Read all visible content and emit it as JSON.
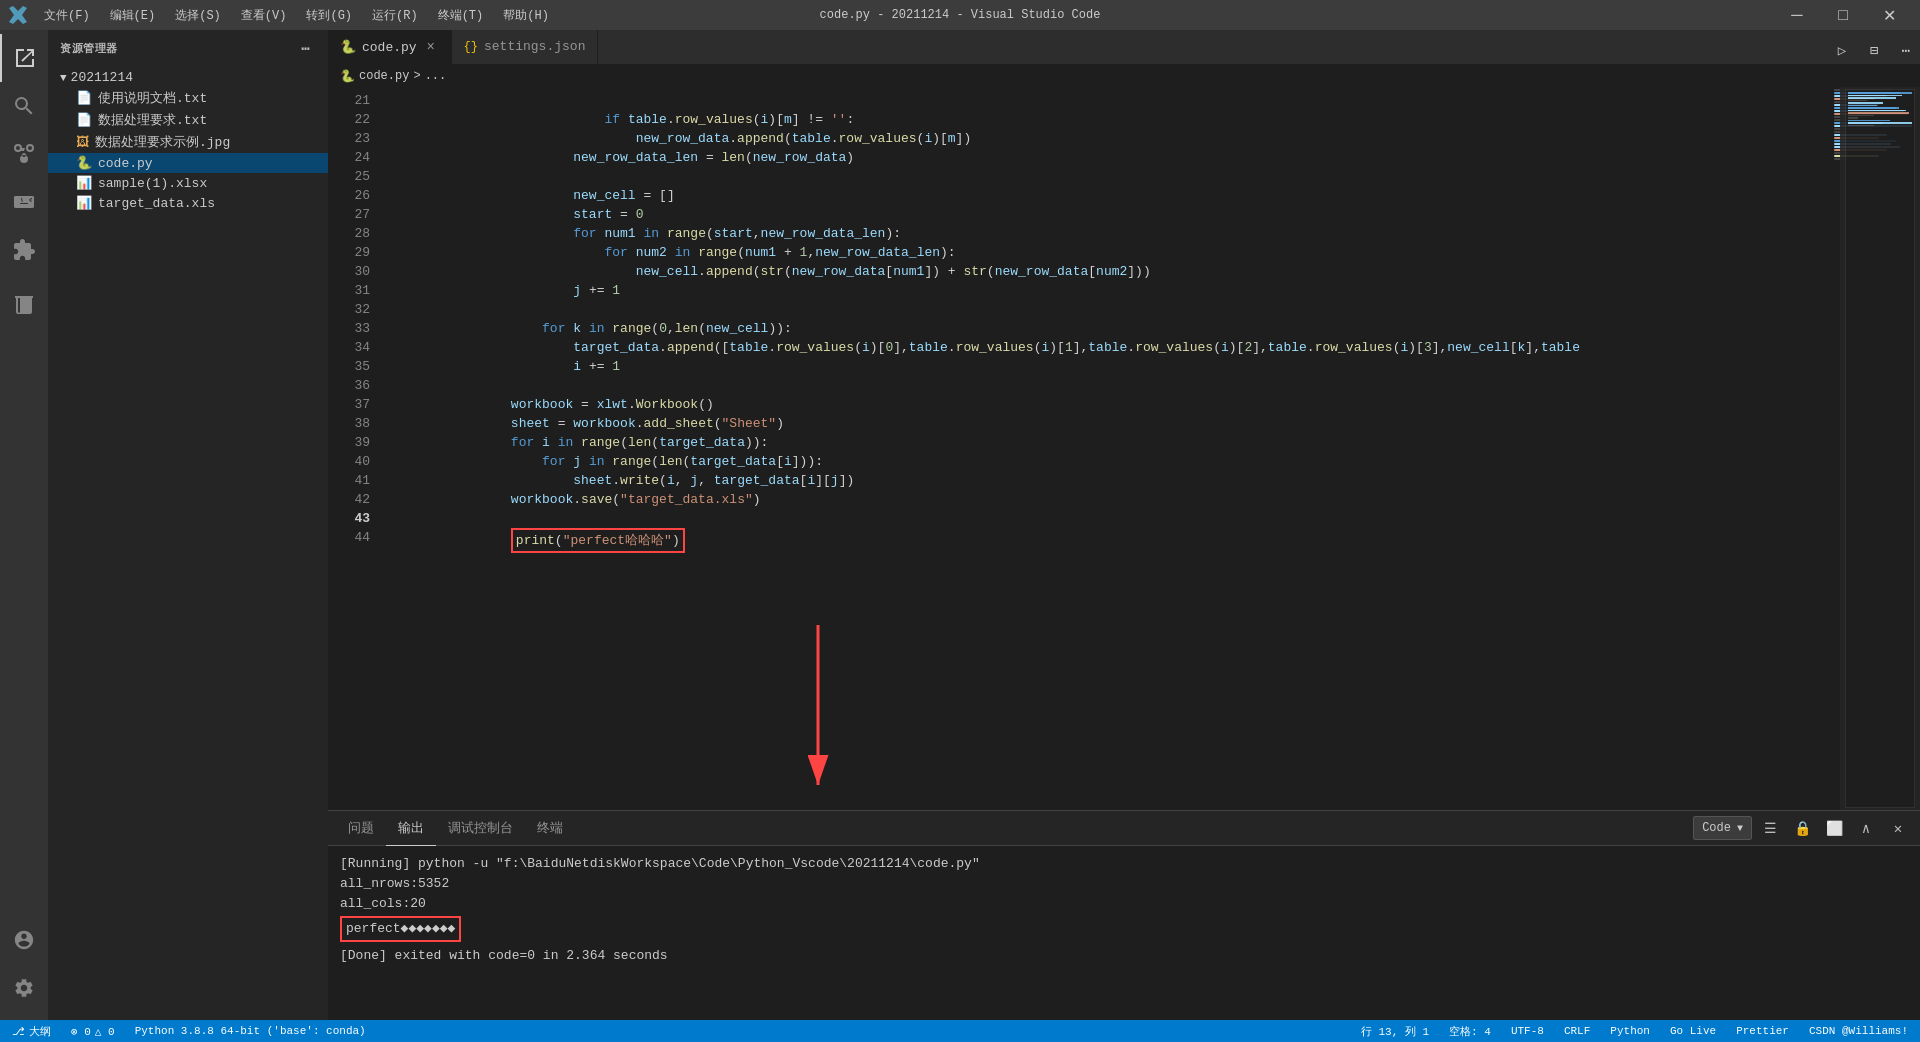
{
  "titleBar": {
    "title": "code.py - 20211214 - Visual Studio Code",
    "menus": [
      "文件(F)",
      "编辑(E)",
      "选择(S)",
      "查看(V)",
      "转到(G)",
      "运行(R)",
      "终端(T)",
      "帮助(H)"
    ],
    "controls": {
      "minimize": "─",
      "maximize": "□",
      "close": "✕"
    }
  },
  "activityBar": {
    "items": [
      {
        "name": "explorer",
        "icon": "⊞",
        "label": "explorer"
      },
      {
        "name": "search",
        "icon": "🔍",
        "label": "search"
      },
      {
        "name": "source-control",
        "icon": "⎇",
        "label": "source-control"
      },
      {
        "name": "run",
        "icon": "▷",
        "label": "run-and-debug"
      },
      {
        "name": "extensions",
        "icon": "⊟",
        "label": "extensions"
      },
      {
        "name": "test",
        "icon": "⚗",
        "label": "testing"
      }
    ],
    "bottomItems": [
      {
        "name": "accounts",
        "icon": "◯",
        "label": "accounts"
      },
      {
        "name": "settings",
        "icon": "⚙",
        "label": "settings"
      }
    ]
  },
  "sidebar": {
    "title": "资源管理器",
    "folderName": "20211214",
    "files": [
      {
        "name": "使用说明文档.txt",
        "type": "txt",
        "icon": "📄"
      },
      {
        "name": "数据处理要求.txt",
        "type": "txt",
        "icon": "📄"
      },
      {
        "name": "数据处理要求示例.jpg",
        "type": "jpg",
        "icon": "🖼"
      },
      {
        "name": "code.py",
        "type": "py",
        "icon": "🐍",
        "active": true
      },
      {
        "name": "sample(1).xlsx",
        "type": "xls",
        "icon": "📊"
      },
      {
        "name": "target_data.xls",
        "type": "xls",
        "icon": "📊"
      }
    ]
  },
  "tabs": [
    {
      "label": "code.py",
      "active": true,
      "type": "py"
    },
    {
      "label": "settings.json",
      "active": false,
      "type": "json"
    }
  ],
  "breadcrumb": [
    "code.py",
    ">",
    "..."
  ],
  "codeLines": [
    {
      "num": 21,
      "content": "                if table.row_values(i)[m] != '':"
    },
    {
      "num": 22,
      "content": "                    new_row_data.append(table.row_values(i)[m])"
    },
    {
      "num": 23,
      "content": "            new_row_data_len = len(new_row_data)"
    },
    {
      "num": 24,
      "content": ""
    },
    {
      "num": 25,
      "content": "            new_cell = []"
    },
    {
      "num": 26,
      "content": "            start = 0"
    },
    {
      "num": 27,
      "content": "            for num1 in range(start,new_row_data_len):"
    },
    {
      "num": 28,
      "content": "                for num2 in range(num1 + 1,new_row_data_len):"
    },
    {
      "num": 29,
      "content": "                    new_cell.append(str(new_row_data[num1]) + str(new_row_data[num2]))"
    },
    {
      "num": 30,
      "content": "            j += 1"
    },
    {
      "num": 31,
      "content": ""
    },
    {
      "num": 32,
      "content": "        for k in range(0,len(new_cell)):"
    },
    {
      "num": 33,
      "content": "            target_data.append([table.row_values(i)[0],table.row_values(i)[1],table.row_values(i)[2],table.row_values(i)[3],new_cell[k],table"
    },
    {
      "num": 34,
      "content": "            i += 1"
    },
    {
      "num": 35,
      "content": ""
    },
    {
      "num": 36,
      "content": "    workbook = xlwt.Workbook()"
    },
    {
      "num": 37,
      "content": "    sheet = workbook.add_sheet(\"Sheet\")"
    },
    {
      "num": 38,
      "content": "    for i in range(len(target_data)):"
    },
    {
      "num": 39,
      "content": "        for j in range(len(target_data[i])):"
    },
    {
      "num": 40,
      "content": "            sheet.write(i, j, target_data[i][j])"
    },
    {
      "num": 41,
      "content": "    workbook.save(\"target_data.xls\")"
    },
    {
      "num": 42,
      "content": ""
    },
    {
      "num": 43,
      "content": "    print(\"perfect哈哈哈\")"
    },
    {
      "num": 44,
      "content": ""
    }
  ],
  "panel": {
    "tabs": [
      "问题",
      "输出",
      "调试控制台",
      "终端"
    ],
    "activeTab": "输出",
    "dropdown": "Code",
    "output": {
      "line1": "[Running] python -u \"f:\\BaiduNetdiskWorkspace\\Code\\Python_Vscode\\20211214\\code.py\"",
      "line2": "all_nrows:5352",
      "line3": "all_cols:20",
      "line4": "perfect◆◆◆◆◆◆◆",
      "line5": "[Done] exited with code=0 in 2.364 seconds"
    }
  },
  "statusBar": {
    "left": {
      "branch": "⎇  大纲",
      "errors": "⚠ 0 △ 0",
      "python": "Python 3.8.8 64-bit ('base': conda)"
    },
    "right": {
      "position": "行 13, 列 1",
      "spaces": "空格: 4",
      "encoding": "UTF-8",
      "lineEnding": "CRLF",
      "language": "Python",
      "goLive": "Go Live",
      "prettier": "Prettier",
      "codeGrade": "CSDN @Williams!"
    }
  }
}
